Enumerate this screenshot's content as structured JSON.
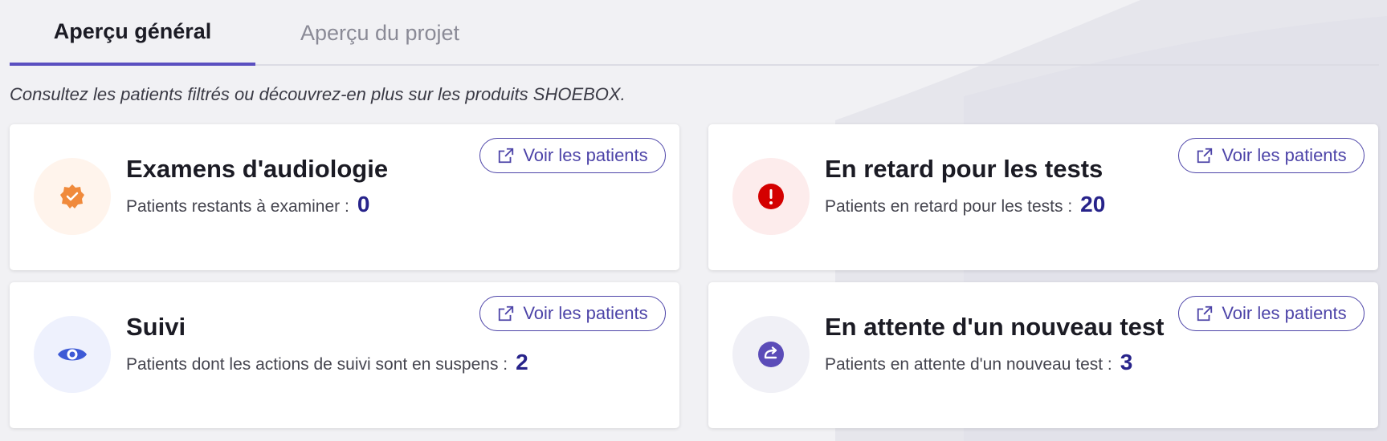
{
  "tabs": [
    {
      "label": "Aperçu général",
      "active": true
    },
    {
      "label": "Aperçu du projet",
      "active": false
    }
  ],
  "subtitle": "Consultez les patients filtrés ou découvrez-en plus sur les produits SHOEBOX.",
  "cards": [
    {
      "title": "Examens d'audiologie",
      "stat_label": "Patients restants à examiner :",
      "stat_value": "0",
      "button_label": "Voir les patients",
      "icon": "verified-badge-icon"
    },
    {
      "title": "En retard pour les tests",
      "stat_label": "Patients en retard pour les tests :",
      "stat_value": "20",
      "button_label": "Voir les patients",
      "icon": "alert-icon"
    },
    {
      "title": "Suivi",
      "stat_label": "Patients dont les actions de suivi sont en suspens :",
      "stat_value": "2",
      "button_label": "Voir les patients",
      "icon": "eye-icon"
    },
    {
      "title": "En attente d'un nouveau test",
      "stat_label": "Patients en attente d'un nouveau test :",
      "stat_value": "3",
      "button_label": "Voir les patients",
      "icon": "redo-icon"
    }
  ],
  "colors": {
    "accent": "#5a4fc0",
    "orange": "#f08a3c",
    "red": "#d40000",
    "blue": "#3d5ad6",
    "purple": "#5b4cb8"
  }
}
